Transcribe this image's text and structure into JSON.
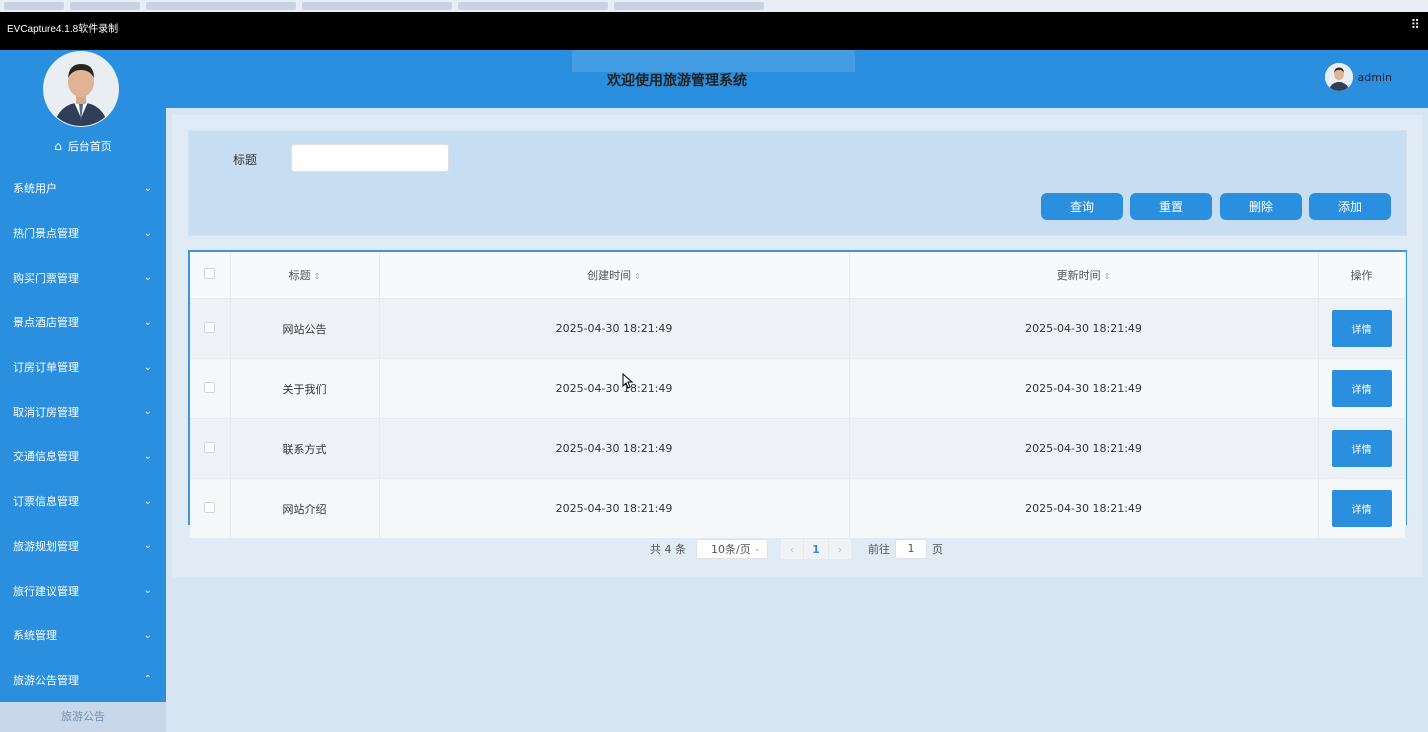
{
  "window": {
    "title": "EVCapture4.1.8软件录制",
    "expand_icon": "expand-icon"
  },
  "header": {
    "title": "欢迎使用旅游管理系统",
    "user": "admin"
  },
  "sidebar": {
    "home": "后台首页",
    "items": [
      {
        "label": "系统用户",
        "chevron": "chevron-down-icon"
      },
      {
        "label": "热门景点管理",
        "chevron": "chevron-down-icon"
      },
      {
        "label": "购买门票管理",
        "chevron": "chevron-down-icon"
      },
      {
        "label": "景点酒店管理",
        "chevron": "chevron-down-icon"
      },
      {
        "label": "订房订单管理",
        "chevron": "chevron-down-icon"
      },
      {
        "label": "取消订房管理",
        "chevron": "chevron-down-icon"
      },
      {
        "label": "交通信息管理",
        "chevron": "chevron-down-icon"
      },
      {
        "label": "订票信息管理",
        "chevron": "chevron-down-icon"
      },
      {
        "label": "旅游规划管理",
        "chevron": "chevron-down-icon"
      },
      {
        "label": "旅行建议管理",
        "chevron": "chevron-down-icon"
      },
      {
        "label": "系统管理",
        "chevron": "chevron-down-icon"
      },
      {
        "label": "旅游公告管理",
        "chevron": "chevron-up-icon"
      }
    ],
    "sub_item": "旅游公告"
  },
  "search": {
    "label": "标题",
    "value": "",
    "buttons": {
      "query": "查询",
      "reset": "重置",
      "delete": "删除",
      "add": "添加"
    }
  },
  "table": {
    "headers": {
      "title": "标题",
      "created": "创建时间",
      "updated": "更新时间",
      "action": "操作"
    },
    "sort_icon": "⇕",
    "rows": [
      {
        "title": "网站公告",
        "created": "2025-04-30 18:21:49",
        "updated": "2025-04-30 18:21:49",
        "action": "详情"
      },
      {
        "title": "关于我们",
        "created": "2025-04-30 18:21:49",
        "updated": "2025-04-30 18:21:49",
        "action": "详情"
      },
      {
        "title": "联系方式",
        "created": "2025-04-30 18:21:49",
        "updated": "2025-04-30 18:21:49",
        "action": "详情"
      },
      {
        "title": "网站介绍",
        "created": "2025-04-30 18:21:49",
        "updated": "2025-04-30 18:21:49",
        "action": "详情"
      }
    ]
  },
  "pagination": {
    "total": "共 4 条",
    "page_size": "10条/页",
    "current": "1",
    "goto_prefix": "前往",
    "goto_value": "1",
    "goto_suffix": "页"
  },
  "colors": {
    "primary": "#2b8fe0",
    "page_bg": "#d8e6f3",
    "panel_bg": "#c6ddf2"
  }
}
